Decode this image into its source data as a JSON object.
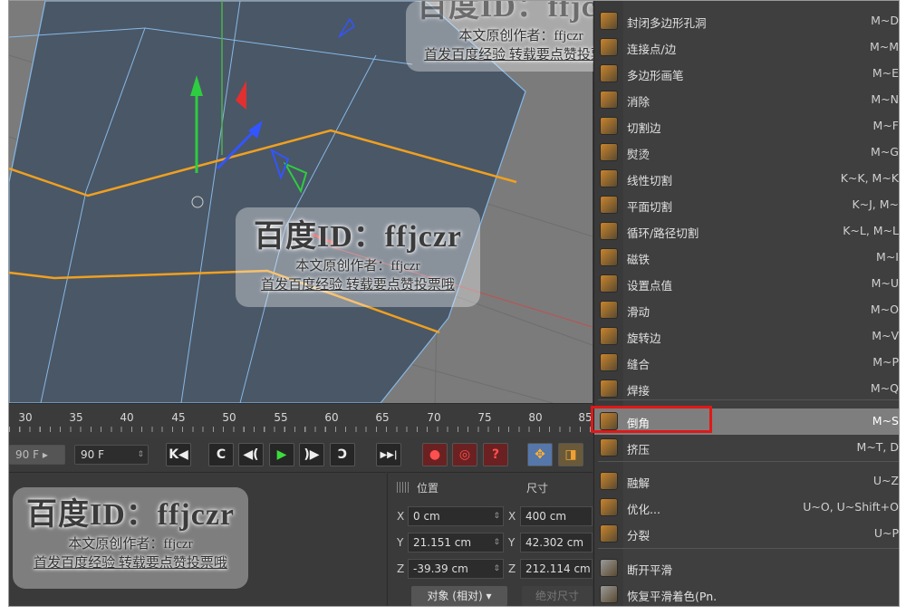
{
  "timeline": {
    "ticks": [
      "30",
      "35",
      "40",
      "45",
      "50",
      "55",
      "60",
      "65",
      "70",
      "75",
      "80",
      "85"
    ]
  },
  "transport": {
    "start_frame": "90 F",
    "end_frame": "90 F",
    "buttons": {
      "goto_start": "K◀",
      "prev_key": "C",
      "prev_frame": "◀(",
      "play": "▶",
      "next_frame": ")▶",
      "next_key": "Ɔ",
      "goto_end": "▶▶|",
      "record": "●",
      "autokey": "◎",
      "keyframe_help": "?",
      "move": "✥",
      "scale": "◨"
    }
  },
  "attributes": {
    "position_header": "位置",
    "size_header": "尺寸",
    "rows": [
      {
        "axis": "X",
        "position": "0 cm",
        "size_axis": "X",
        "size": "400 cm"
      },
      {
        "axis": "Y",
        "position": "21.151 cm",
        "size_axis": "Y",
        "size": "42.302 cm"
      },
      {
        "axis": "Z",
        "position": "-39.39 cm",
        "size_axis": "Z",
        "size": "212.114 cm"
      }
    ],
    "coord_mode": "对象 (相对)",
    "absolute_size": "绝对尺寸"
  },
  "menu": {
    "items": [
      {
        "label": "封闭多边形孔洞",
        "shortcut": "M~D",
        "icon": "close-hole-icon",
        "color": "#c9842c"
      },
      {
        "label": "连接点/边",
        "shortcut": "M~M",
        "icon": "connect-points-icon",
        "color": "#c9842c"
      },
      {
        "label": "多边形画笔",
        "shortcut": "M~E",
        "icon": "polygon-pen-icon",
        "color": "#c9842c"
      },
      {
        "label": "消除",
        "shortcut": "M~N",
        "icon": "dissolve-icon",
        "color": "#c9842c"
      },
      {
        "label": "切割边",
        "shortcut": "M~F",
        "icon": "edge-cut-icon",
        "color": "#c9842c"
      },
      {
        "label": "熨烫",
        "shortcut": "M~G",
        "icon": "iron-icon",
        "color": "#c9842c"
      },
      {
        "label": "线性切割",
        "shortcut": "K~K, M~K",
        "icon": "line-cut-icon",
        "color": "#c9842c"
      },
      {
        "label": "平面切割",
        "shortcut": "K~J, M~",
        "icon": "plane-cut-icon",
        "color": "#c9842c"
      },
      {
        "label": "循环/路径切割",
        "shortcut": "K~L, M~L",
        "icon": "loop-cut-icon",
        "color": "#c9842c"
      },
      {
        "label": "磁铁",
        "shortcut": "M~I",
        "icon": "magnet-icon",
        "color": "#c9842c"
      },
      {
        "label": "设置点值",
        "shortcut": "M~U",
        "icon": "set-point-value-icon",
        "color": "#c9842c"
      },
      {
        "label": "滑动",
        "shortcut": "M~O",
        "icon": "slide-icon",
        "color": "#c9842c"
      },
      {
        "label": "旋转边",
        "shortcut": "M~V",
        "icon": "spin-edge-icon",
        "color": "#c9842c"
      },
      {
        "label": "缝合",
        "shortcut": "M~P",
        "icon": "stitch-icon",
        "color": "#c9842c"
      },
      {
        "label": "焊接",
        "shortcut": "M~Q",
        "icon": "weld-icon",
        "color": "#c9842c"
      },
      {
        "label": "倒角",
        "shortcut": "M~S",
        "icon": "bevel-icon",
        "color": "#c9842c",
        "highlighted": true
      },
      {
        "label": "挤压",
        "shortcut": "M~T, D",
        "icon": "extrude-icon",
        "color": "#c9842c"
      },
      {
        "label": "融解",
        "shortcut": "U~Z",
        "icon": "melt-icon",
        "color": "#c9842c"
      },
      {
        "label": "优化...",
        "shortcut": "U~O, U~Shift+O",
        "icon": "optimize-icon",
        "color": "#c9842c"
      },
      {
        "label": "分裂",
        "shortcut": "U~P",
        "icon": "split-icon",
        "color": "#c9842c"
      },
      {
        "label": "断开平滑",
        "shortcut": "",
        "icon": "break-phong-icon",
        "color": "#9a9a9a"
      },
      {
        "label": "恢复平滑着色(Pn.",
        "shortcut": "",
        "icon": "unbreak-phong-icon",
        "color": "#9a9a9a"
      }
    ]
  },
  "watermark": {
    "id_text": "百度ID：ffjczr",
    "author": "本文原创作者：ffjczr",
    "note": "首发百度经验  转载要点赞投票哦"
  },
  "colors": {
    "highlight_box": "#e01818",
    "edge_selection": "#f0a020",
    "mesh_fill": "#4a5766",
    "mesh_lines": "#86b8e6"
  }
}
